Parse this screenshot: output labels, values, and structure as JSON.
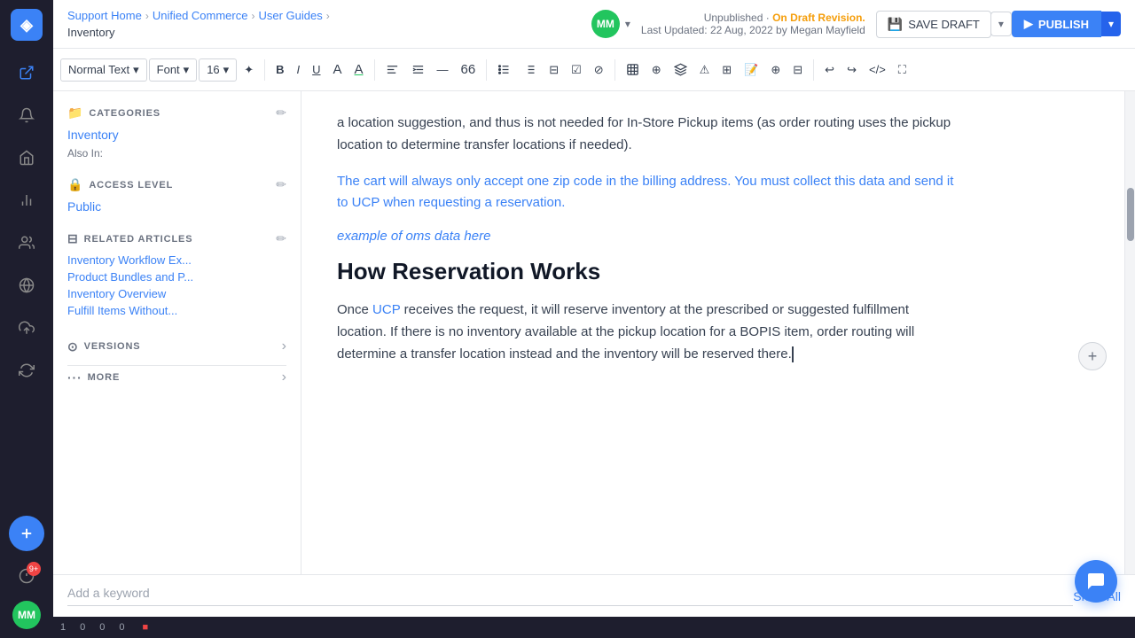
{
  "nav": {
    "logo": "◈",
    "items": [
      {
        "id": "link",
        "icon": "↗",
        "active": true
      },
      {
        "id": "bell",
        "icon": "🔔"
      },
      {
        "id": "home",
        "icon": "⌂"
      },
      {
        "id": "chart",
        "icon": "📊"
      },
      {
        "id": "users",
        "icon": "👥"
      },
      {
        "id": "globe",
        "icon": "🌐"
      },
      {
        "id": "cloud",
        "icon": "☁"
      },
      {
        "id": "refresh",
        "icon": "↻"
      }
    ],
    "bottom_avatar_label": "MM",
    "badge_count": "9+"
  },
  "top_bar": {
    "breadcrumb": {
      "support_home": "Support Home",
      "unified_commerce": "Unified Commerce",
      "user_guides": "User Guides",
      "current": "Inventory"
    },
    "user_avatar": "MM",
    "status": {
      "unpublished": "Unpublished · ",
      "draft": "On Draft Revision.",
      "updated": "Last Updated: 22 Aug, 2022 by Megan Mayfield"
    },
    "save_draft_label": "SAVE DRAFT",
    "publish_label": "PUBLISH"
  },
  "toolbar": {
    "text_style": "Normal Text",
    "font": "Font",
    "font_size": "16",
    "items": [
      "B",
      "I",
      "U",
      "A",
      "A",
      "≡",
      "⊟",
      "¶",
      "✦",
      "⊕",
      "🔗",
      "📎",
      "🗂",
      "🖼",
      "⊞",
      "📝"
    ]
  },
  "sidebar": {
    "categories_title": "CATEGORIES",
    "categories_link": "Inventory",
    "also_in_label": "Also In:",
    "access_level_title": "ACCESS LEVEL",
    "access_level_value": "Public",
    "related_articles_title": "RELATED ARTICLES",
    "related_articles": [
      "Inventory Workflow Ex...",
      "Product Bundles and P...",
      "Inventory Overview",
      "Fulfill Items Without..."
    ],
    "versions_label": "VERSIONS",
    "more_label": "MORE"
  },
  "editor": {
    "paragraph1": "a location suggestion, and thus is not needed for In-Store Pickup items (as order routing uses the pickup location to determine transfer locations if needed).",
    "paragraph2": "The cart will always only accept one zip code in the billing address. You must collect this data and send it to UCP when requesting a reservation.",
    "italic_link": "example of oms data here",
    "heading": "How Reservation Works",
    "paragraph3": "Once UCP receives the request, it will reserve inventory at the prescribed or suggested fulfillment location. If there is no inventory available at the pickup location for a BOPIS item, order routing will determine a transfer location instead and the inventory will be reserved there."
  },
  "keyword_bar": {
    "placeholder": "Add a keyword",
    "show_all": "Show All"
  },
  "analytics": {
    "items": [
      {
        "value": "1",
        "label": ""
      },
      {
        "value": "0",
        "label": ""
      },
      {
        "value": "0",
        "label": ""
      },
      {
        "value": "0",
        "label": ""
      }
    ]
  }
}
